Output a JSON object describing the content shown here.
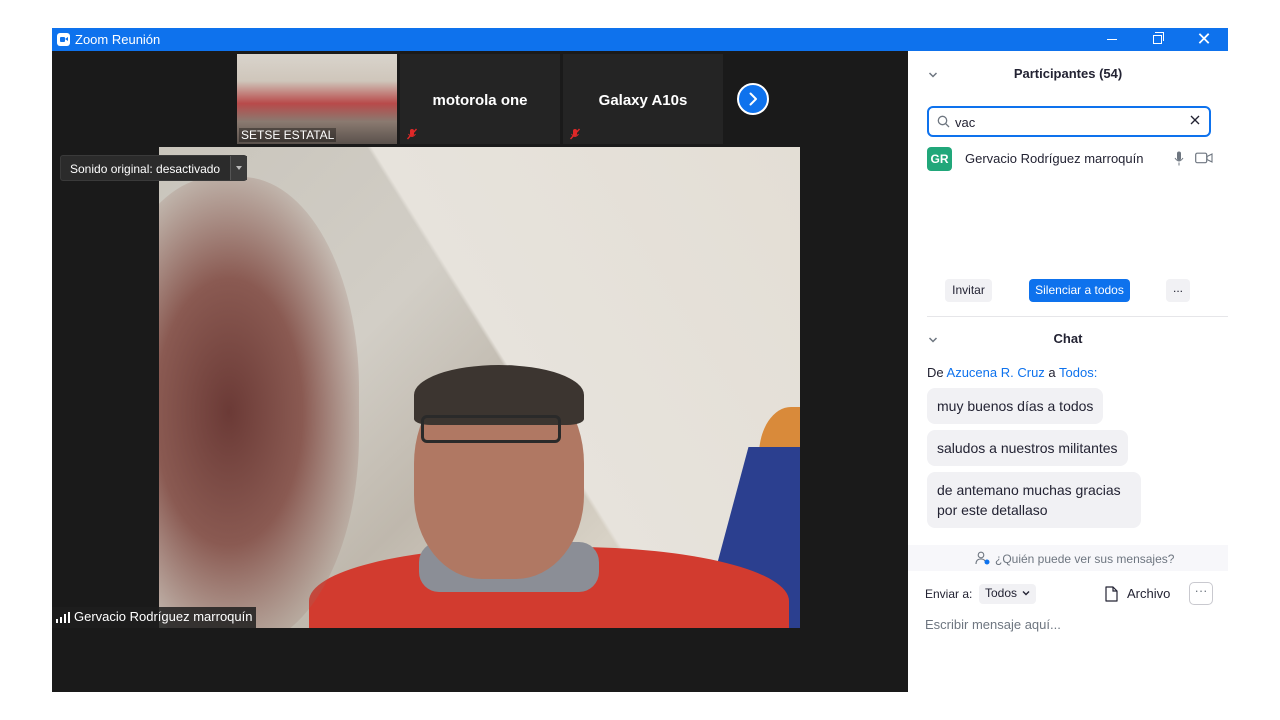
{
  "window": {
    "title": "Zoom Reunión"
  },
  "gallery": {
    "thumbnails": [
      {
        "name": "SETSE ESTATAL",
        "muted": false
      },
      {
        "name": "motorola one",
        "muted": true
      },
      {
        "name": "Galaxy A10s",
        "muted": true
      }
    ]
  },
  "main_video": {
    "speaker_name": "Gervacio Rodríguez marroquín",
    "sound_original": "Sonido original: desactivado"
  },
  "participants": {
    "title": "Participantes (54)",
    "search_value": "vac",
    "list": [
      {
        "initials": "GR",
        "name": "Gervacio Rodríguez marroquín",
        "avatar_color": "#21a77a"
      }
    ],
    "invite_label": "Invitar",
    "mute_all_label": "Silenciar a todos",
    "more_label": "..."
  },
  "chat": {
    "title": "Chat",
    "from_prefix": "De",
    "from_sender": "Azucena R. Cruz",
    "from_connector": "a",
    "from_recipient": "Todos:",
    "messages": [
      "muy buenos días a todos",
      "saludos a nuestros militantes",
      "de antemano muchas gracias por este detallaso"
    ],
    "who_can_see": "¿Quién puede ver sus mensajes?",
    "send_to_label": "Enviar a:",
    "send_to_value": "Todos",
    "file_label": "Archivo",
    "more_label": "···",
    "input_placeholder": "Escribir mensaje aquí..."
  },
  "colors": {
    "accent": "#0e72ed",
    "avatar": "#21a77a"
  }
}
